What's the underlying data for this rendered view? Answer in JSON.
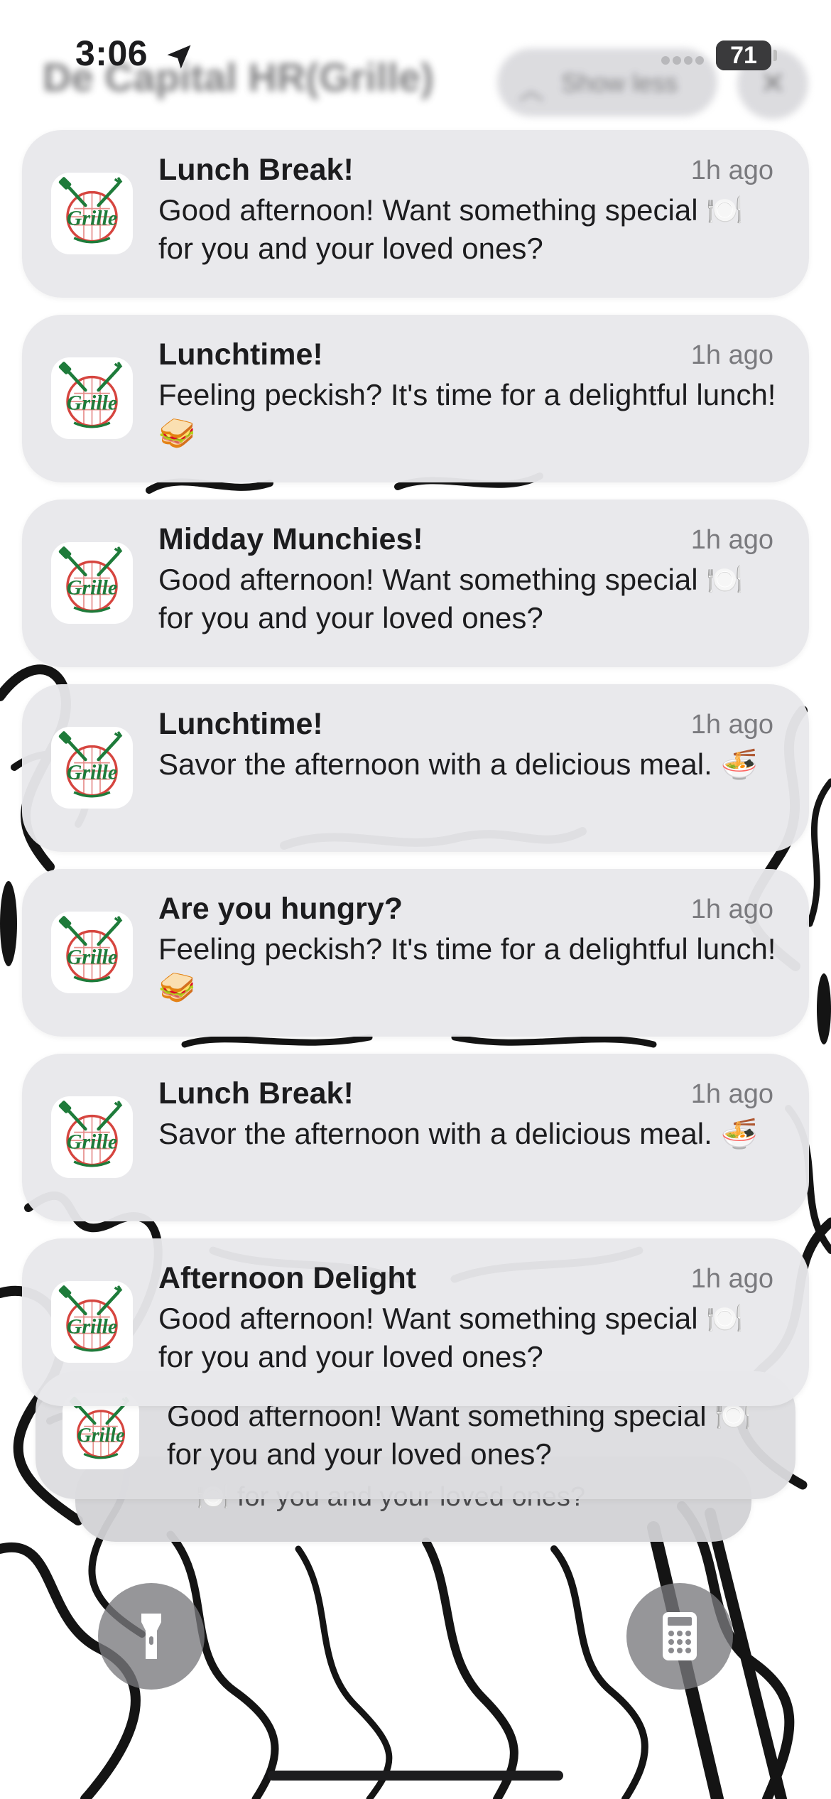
{
  "status_bar": {
    "time": "3:06",
    "battery_level": "71",
    "icons": [
      "location-arrow-icon",
      "signal-dots-icon",
      "battery-icon"
    ]
  },
  "group_header": {
    "title": "De Capital HR(Grille)",
    "show_less_label": "Show less",
    "clear_symbol": "✕"
  },
  "app": {
    "icon_text": "Grille",
    "brand_green": "#1e7b3a",
    "brand_red": "#d6453f"
  },
  "notifications": [
    {
      "title": "Lunch Break!",
      "time": "1h ago",
      "body": "Good afternoon! Want something special 🍽️ for you and your loved ones?"
    },
    {
      "title": "Lunchtime!",
      "time": "1h ago",
      "body": "Feeling peckish? It's time for a delightful lunch! 🥪"
    },
    {
      "title": "Midday Munchies!",
      "time": "1h ago",
      "body": "Good afternoon! Want something special 🍽️ for you and your loved ones?"
    },
    {
      "title": "Lunchtime!",
      "time": "1h ago",
      "body": "Savor the afternoon with a delicious meal. 🍜"
    },
    {
      "title": "Are you hungry?",
      "time": "1h ago",
      "body": "Feeling peckish? It's time for a delightful lunch! 🥪"
    },
    {
      "title": "Lunch Break!",
      "time": "1h ago",
      "body": "Savor the afternoon with a delicious meal. 🍜"
    },
    {
      "title": "Afternoon Delight",
      "time": "1h ago",
      "body": "Good afternoon! Want something special 🍽️ for you and your loved ones?"
    }
  ],
  "stacked_notifications": [
    {
      "body": "Good afternoon! Want something special 🍽️ for you and your loved ones?"
    },
    {
      "body": "🍽️ for you and your loved ones?"
    }
  ],
  "quick_actions": {
    "flashlight_icon": "flashlight-icon",
    "calculator_icon": "calculator-icon"
  }
}
